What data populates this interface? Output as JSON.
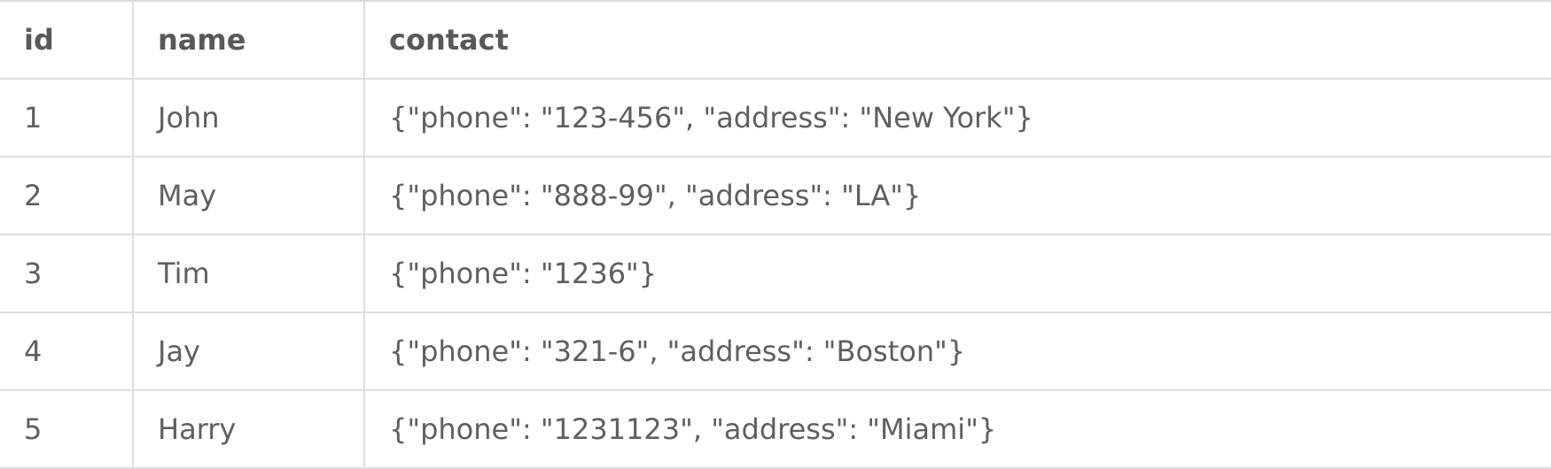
{
  "table": {
    "columns": [
      "id",
      "name",
      "contact"
    ],
    "rows": [
      [
        "1",
        "John",
        "{\"phone\": \"123-456\", \"address\": \"New York\"}"
      ],
      [
        "2",
        "May",
        "{\"phone\": \"888-99\", \"address\": \"LA\"}"
      ],
      [
        "3",
        "Tim",
        "{\"phone\": \"1236\"}"
      ],
      [
        "4",
        "Jay",
        "{\"phone\": \"321-6\", \"address\": \"Boston\"}"
      ],
      [
        "5",
        "Harry",
        "{\"phone\": \"1231123\", \"address\": \"Miami\"}"
      ]
    ]
  }
}
